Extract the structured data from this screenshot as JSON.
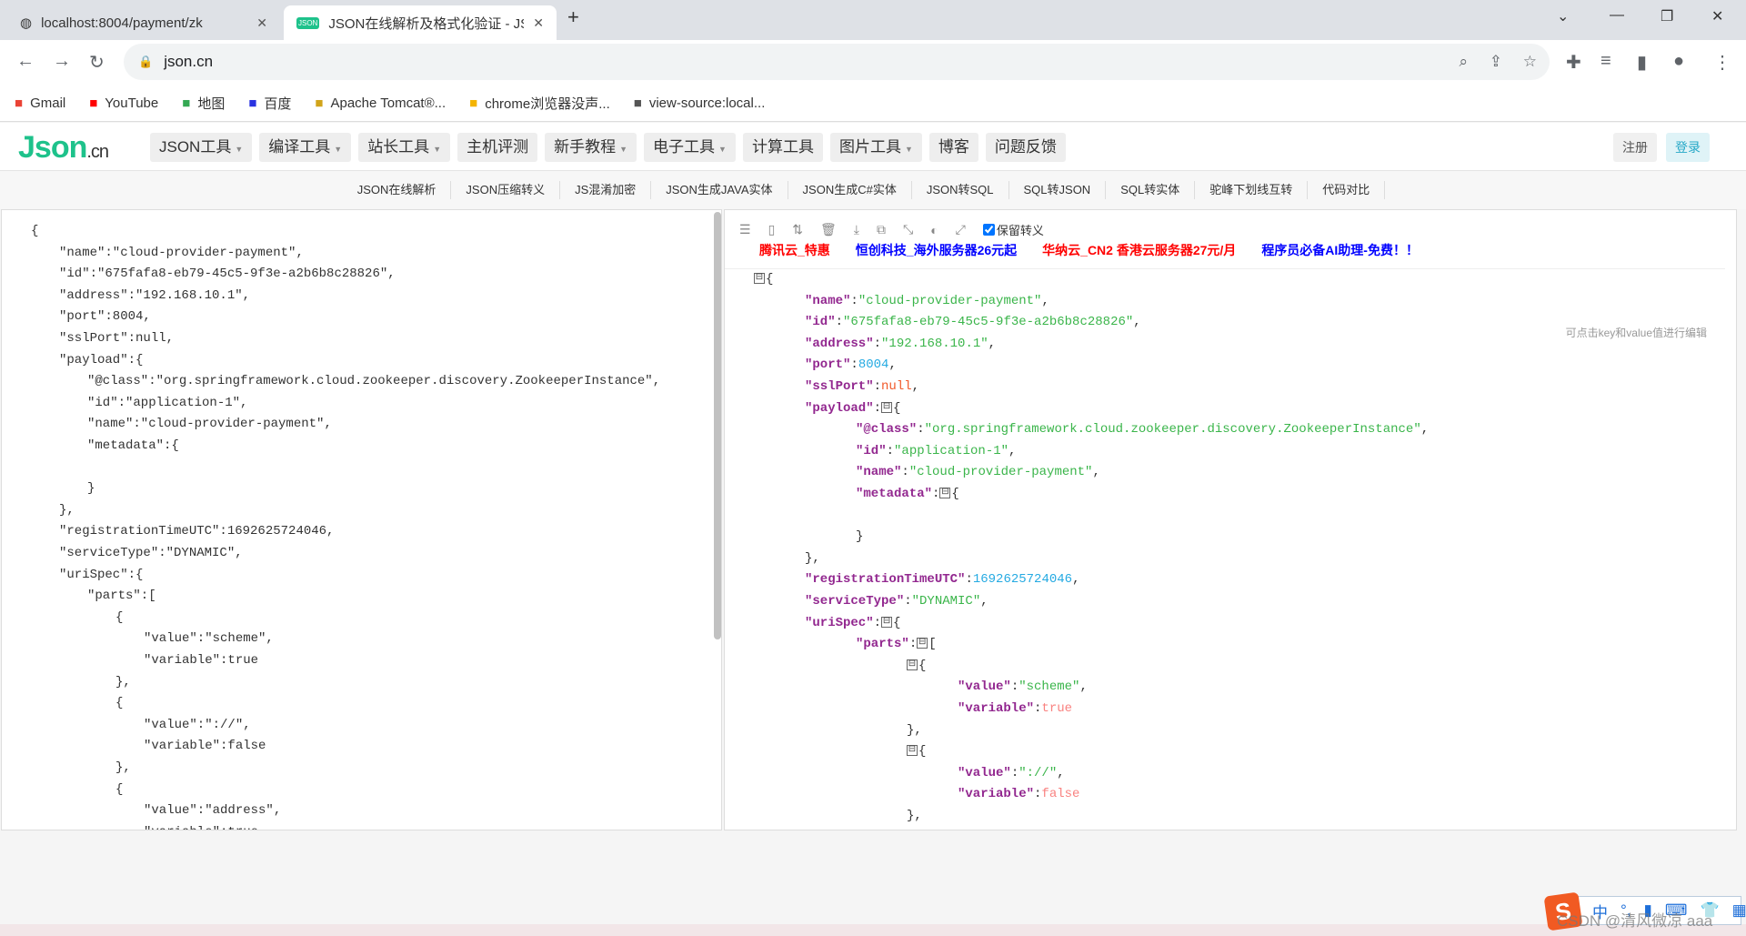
{
  "browser": {
    "tabs": [
      {
        "title": "localhost:8004/payment/zk"
      },
      {
        "title": "JSON在线解析及格式化验证 - JS"
      }
    ],
    "url": "json.cn",
    "bookmarks": [
      {
        "label": "Gmail",
        "icon": "gmail-icon",
        "color": "#ea4335"
      },
      {
        "label": "YouTube",
        "icon": "youtube-icon",
        "color": "#ff0000"
      },
      {
        "label": "地图",
        "icon": "maps-icon",
        "color": "#34a853"
      },
      {
        "label": "百度",
        "icon": "baidu-icon",
        "color": "#2932e1"
      },
      {
        "label": "Apache Tomcat®...",
        "icon": "tomcat-icon",
        "color": "#d1a41a"
      },
      {
        "label": "chrome浏览器没声...",
        "icon": "chrome-icon",
        "color": "#f4b400"
      },
      {
        "label": "view-source:local...",
        "icon": "globe-icon",
        "color": "#555"
      }
    ]
  },
  "site": {
    "logo": "Json",
    "logo_suffix": ".cn",
    "menu": [
      {
        "label": "JSON工具",
        "dropdown": true
      },
      {
        "label": "编译工具",
        "dropdown": true
      },
      {
        "label": "站长工具",
        "dropdown": true
      },
      {
        "label": "主机评测",
        "dropdown": false
      },
      {
        "label": "新手教程",
        "dropdown": true
      },
      {
        "label": "电子工具",
        "dropdown": true
      },
      {
        "label": "计算工具",
        "dropdown": false
      },
      {
        "label": "图片工具",
        "dropdown": true
      },
      {
        "label": "博客",
        "dropdown": false
      },
      {
        "label": "问题反馈",
        "dropdown": false
      }
    ],
    "register": "注册",
    "login": "登录",
    "subnav": [
      "JSON在线解析",
      "JSON压缩转义",
      "JS混淆加密",
      "JSON生成JAVA实体",
      "JSON生成C#实体",
      "JSON转SQL",
      "SQL转JSON",
      "SQL转实体",
      "驼峰下划线互转",
      "代码对比"
    ]
  },
  "editor": {
    "left_lines": [
      [
        0,
        "{"
      ],
      [
        1,
        "\"name\":\"cloud-provider-payment\","
      ],
      [
        1,
        "\"id\":\"675fafa8-eb79-45c5-9f3e-a2b6b8c28826\","
      ],
      [
        1,
        "\"address\":\"192.168.10.1\","
      ],
      [
        1,
        "\"port\":8004,"
      ],
      [
        1,
        "\"sslPort\":null,"
      ],
      [
        1,
        "\"payload\":{"
      ],
      [
        2,
        "\"@class\":\"org.springframework.cloud.zookeeper.discovery.ZookeeperInstance\","
      ],
      [
        2,
        "\"id\":\"application-1\","
      ],
      [
        2,
        "\"name\":\"cloud-provider-payment\","
      ],
      [
        2,
        "\"metadata\":{"
      ],
      [
        2,
        ""
      ],
      [
        2,
        "}"
      ],
      [
        1,
        "},"
      ],
      [
        1,
        "\"registrationTimeUTC\":1692625724046,"
      ],
      [
        1,
        "\"serviceType\":\"DYNAMIC\","
      ],
      [
        1,
        "\"uriSpec\":{"
      ],
      [
        2,
        "\"parts\":["
      ],
      [
        3,
        "{"
      ],
      [
        4,
        "\"value\":\"scheme\","
      ],
      [
        4,
        "\"variable\":true"
      ],
      [
        3,
        "},"
      ],
      [
        3,
        "{"
      ],
      [
        4,
        "\"value\":\"://\","
      ],
      [
        4,
        "\"variable\":false"
      ],
      [
        3,
        "},"
      ],
      [
        3,
        "{"
      ],
      [
        4,
        "\"value\":\"address\","
      ],
      [
        4,
        "\"variable\":true"
      ]
    ],
    "toolbar_icons": [
      "database-icon",
      "excel-icon",
      "sort-icon",
      "trash-icon",
      "download-icon",
      "copy-icon",
      "compress-icon",
      "share-icon",
      "expand-icon"
    ],
    "keep_escape_label": "保留转义",
    "keep_escape_checked": true,
    "ads": [
      {
        "text": "腾讯云_特惠",
        "color": "#ff0000"
      },
      {
        "text": "恒创科技_海外服务器26元起",
        "color": "#0000ff"
      },
      {
        "text": "华纳云_CN2 香港云服务器27元/月",
        "color": "#ff0000"
      },
      {
        "text": "程序员必备AI助理-免费！！",
        "color": "#0000ff"
      }
    ],
    "hint": "可点击key和value值进行编辑",
    "tree_lines": [
      [
        0,
        [
          [
            "tg",
            "⊟"
          ],
          [
            "p",
            "{"
          ]
        ]
      ],
      [
        1,
        [
          [
            "k",
            "\"name\""
          ],
          [
            "p",
            ":"
          ],
          [
            "s",
            "\"cloud-provider-payment\""
          ],
          [
            "p",
            ","
          ]
        ]
      ],
      [
        1,
        [
          [
            "k",
            "\"id\""
          ],
          [
            "p",
            ":"
          ],
          [
            "s",
            "\"675fafa8-eb79-45c5-9f3e-a2b6b8c28826\""
          ],
          [
            "p",
            ","
          ]
        ]
      ],
      [
        1,
        [
          [
            "k",
            "\"address\""
          ],
          [
            "p",
            ":"
          ],
          [
            "s",
            "\"192.168.10.1\""
          ],
          [
            "p",
            ","
          ]
        ]
      ],
      [
        1,
        [
          [
            "k",
            "\"port\""
          ],
          [
            "p",
            ":"
          ],
          [
            "n",
            "8004"
          ],
          [
            "p",
            ","
          ]
        ]
      ],
      [
        1,
        [
          [
            "k",
            "\"sslPort\""
          ],
          [
            "p",
            ":"
          ],
          [
            "nl",
            "null"
          ],
          [
            "p",
            ","
          ]
        ]
      ],
      [
        1,
        [
          [
            "k",
            "\"payload\""
          ],
          [
            "p",
            ":"
          ],
          [
            "tg",
            "⊟"
          ],
          [
            "p",
            "{"
          ]
        ]
      ],
      [
        2,
        [
          [
            "k",
            "\"@class\""
          ],
          [
            "p",
            ":"
          ],
          [
            "s",
            "\"org.springframework.cloud.zookeeper.discovery.ZookeeperInstance\""
          ],
          [
            "p",
            ","
          ]
        ]
      ],
      [
        2,
        [
          [
            "k",
            "\"id\""
          ],
          [
            "p",
            ":"
          ],
          [
            "s",
            "\"application-1\""
          ],
          [
            "p",
            ","
          ]
        ]
      ],
      [
        2,
        [
          [
            "k",
            "\"name\""
          ],
          [
            "p",
            ":"
          ],
          [
            "s",
            "\"cloud-provider-payment\""
          ],
          [
            "p",
            ","
          ]
        ]
      ],
      [
        2,
        [
          [
            "k",
            "\"metadata\""
          ],
          [
            "p",
            ":"
          ],
          [
            "tg",
            "⊟"
          ],
          [
            "p",
            "{"
          ]
        ]
      ],
      [
        2,
        []
      ],
      [
        2,
        [
          [
            "p",
            "}"
          ]
        ]
      ],
      [
        1,
        [
          [
            "p",
            "},"
          ]
        ]
      ],
      [
        1,
        [
          [
            "k",
            "\"registrationTimeUTC\""
          ],
          [
            "p",
            ":"
          ],
          [
            "n",
            "1692625724046"
          ],
          [
            "p",
            ","
          ]
        ]
      ],
      [
        1,
        [
          [
            "k",
            "\"serviceType\""
          ],
          [
            "p",
            ":"
          ],
          [
            "s",
            "\"DYNAMIC\""
          ],
          [
            "p",
            ","
          ]
        ]
      ],
      [
        1,
        [
          [
            "k",
            "\"uriSpec\""
          ],
          [
            "p",
            ":"
          ],
          [
            "tg",
            "⊟"
          ],
          [
            "p",
            "{"
          ]
        ]
      ],
      [
        2,
        [
          [
            "k",
            "\"parts\""
          ],
          [
            "p",
            ":"
          ],
          [
            "tg",
            "⊟"
          ],
          [
            "p",
            "["
          ]
        ]
      ],
      [
        3,
        [
          [
            "tg",
            "⊟"
          ],
          [
            "p",
            "{"
          ]
        ]
      ],
      [
        4,
        [
          [
            "k",
            "\"value\""
          ],
          [
            "p",
            ":"
          ],
          [
            "s",
            "\"scheme\""
          ],
          [
            "p",
            ","
          ]
        ]
      ],
      [
        4,
        [
          [
            "k",
            "\"variable\""
          ],
          [
            "p",
            ":"
          ],
          [
            "b",
            "true"
          ]
        ]
      ],
      [
        3,
        [
          [
            "p",
            "},"
          ]
        ]
      ],
      [
        3,
        [
          [
            "tg",
            "⊟"
          ],
          [
            "p",
            "{"
          ]
        ]
      ],
      [
        4,
        [
          [
            "k",
            "\"value\""
          ],
          [
            "p",
            ":"
          ],
          [
            "s",
            "\"://\""
          ],
          [
            "p",
            ","
          ]
        ]
      ],
      [
        4,
        [
          [
            "k",
            "\"variable\""
          ],
          [
            "p",
            ":"
          ],
          [
            "b",
            "false"
          ]
        ]
      ],
      [
        3,
        [
          [
            "p",
            "},"
          ]
        ]
      ]
    ]
  },
  "taskbar": {
    "ime_label": "中",
    "watermark": "CSDN @清风微凉 aaa"
  }
}
